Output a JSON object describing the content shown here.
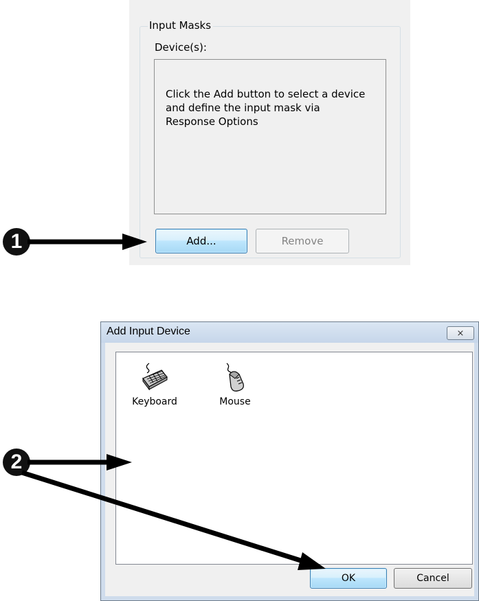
{
  "input_masks": {
    "group_title": "Input Masks",
    "devices_label": "Device(s):",
    "hint_text": "Click the Add button to select a device and define the input mask via Response Options",
    "add_button": "Add...",
    "remove_button": "Remove"
  },
  "callouts": {
    "first": "1",
    "second": "2"
  },
  "add_input_device_dialog": {
    "title": "Add Input Device",
    "close_glyph": "⨯",
    "devices": [
      {
        "label": "Keyboard",
        "icon": "keyboard-icon"
      },
      {
        "label": "Mouse",
        "icon": "mouse-icon"
      }
    ],
    "ok_button": "OK",
    "cancel_button": "Cancel"
  },
  "colors": {
    "default_button_border": "#3c7fb1",
    "callout": "#111111",
    "arrow": "#000000"
  }
}
